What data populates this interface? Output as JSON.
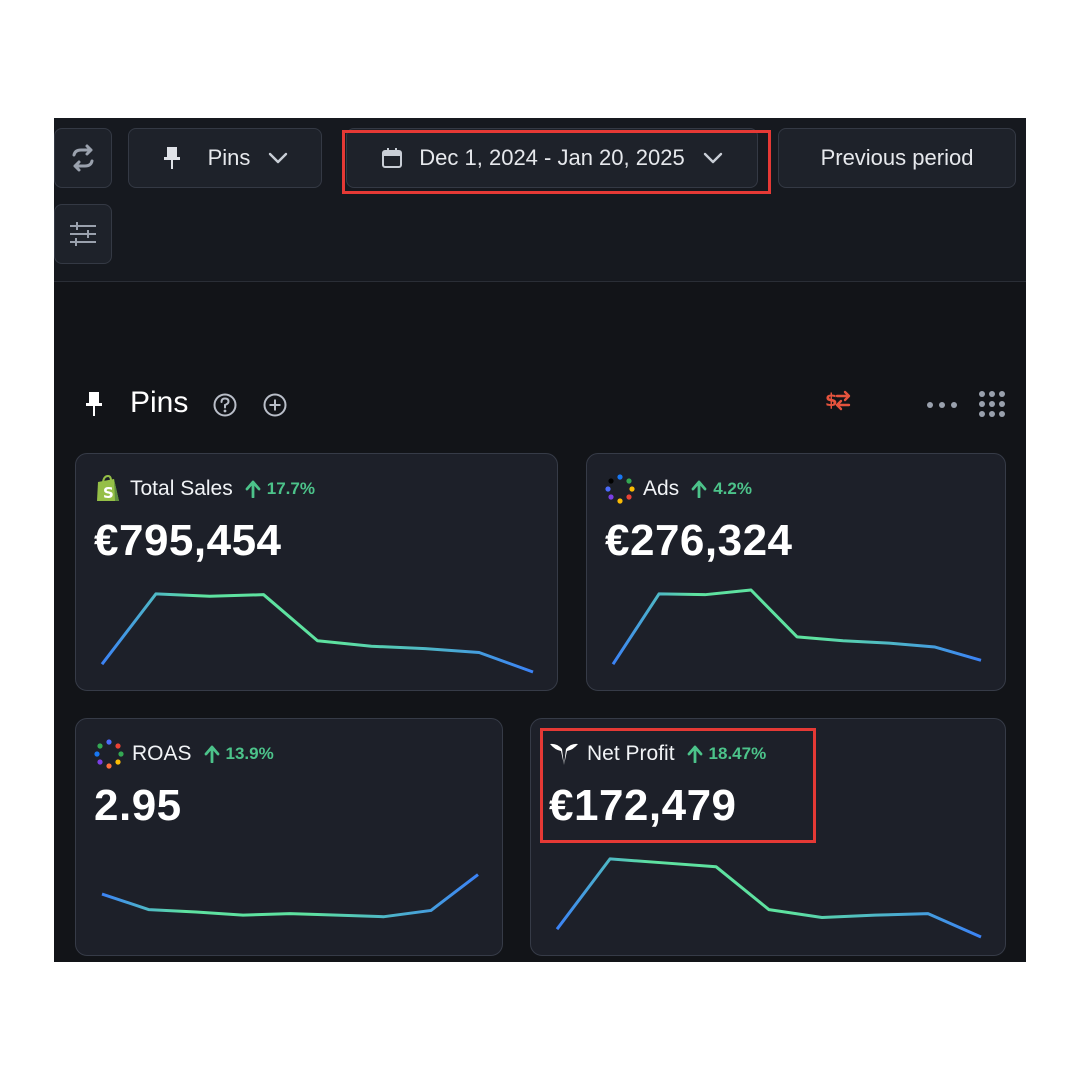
{
  "toolbar": {
    "refresh_icon": "refresh-icon",
    "pins_label": "Pins",
    "date_range": "Dec 1, 2024 - Jan 20, 2025",
    "compare_label": "Previous period",
    "filters_icon": "sliders-icon"
  },
  "section": {
    "title": "Pins",
    "help_icon": "question-circle-icon",
    "add_icon": "plus-circle-icon",
    "currency_icon": "currency-swap-icon",
    "more_icon": "more-dots-icon",
    "grid_icon": "grid-icon"
  },
  "colors": {
    "background": "#121418",
    "card": "#1d2029",
    "positive": "#4cc38a",
    "spark_start": "#3b82f6",
    "spark_peak": "#5ee2a0",
    "highlight": "#e53935",
    "currency_icon": "#e5533d"
  },
  "cards": [
    {
      "title": "Total Sales",
      "delta": "17.7%",
      "value": "€795,454",
      "icon": "shopify-icon",
      "spark": [
        0.1,
        1.0,
        0.97,
        0.99,
        0.4,
        0.33,
        0.3,
        0.25,
        0.0
      ]
    },
    {
      "title": "Ads",
      "delta": "4.2%",
      "value": "€276,324",
      "icon": "ads-dots-icon",
      "spark": [
        0.1,
        1.0,
        0.99,
        1.05,
        0.45,
        0.4,
        0.37,
        0.32,
        0.15
      ]
    },
    {
      "title": "ROAS",
      "delta": "13.9%",
      "value": "2.95",
      "icon": "roas-dots-icon",
      "spark": [
        0.55,
        0.35,
        0.32,
        0.28,
        0.3,
        0.28,
        0.26,
        0.34,
        0.8
      ]
    },
    {
      "title": "Net Profit",
      "delta": "18.47%",
      "value": "€172,479",
      "icon": "triple-whale-icon",
      "spark": [
        0.1,
        1.0,
        0.95,
        0.9,
        0.35,
        0.25,
        0.28,
        0.3,
        0.0
      ]
    }
  ]
}
